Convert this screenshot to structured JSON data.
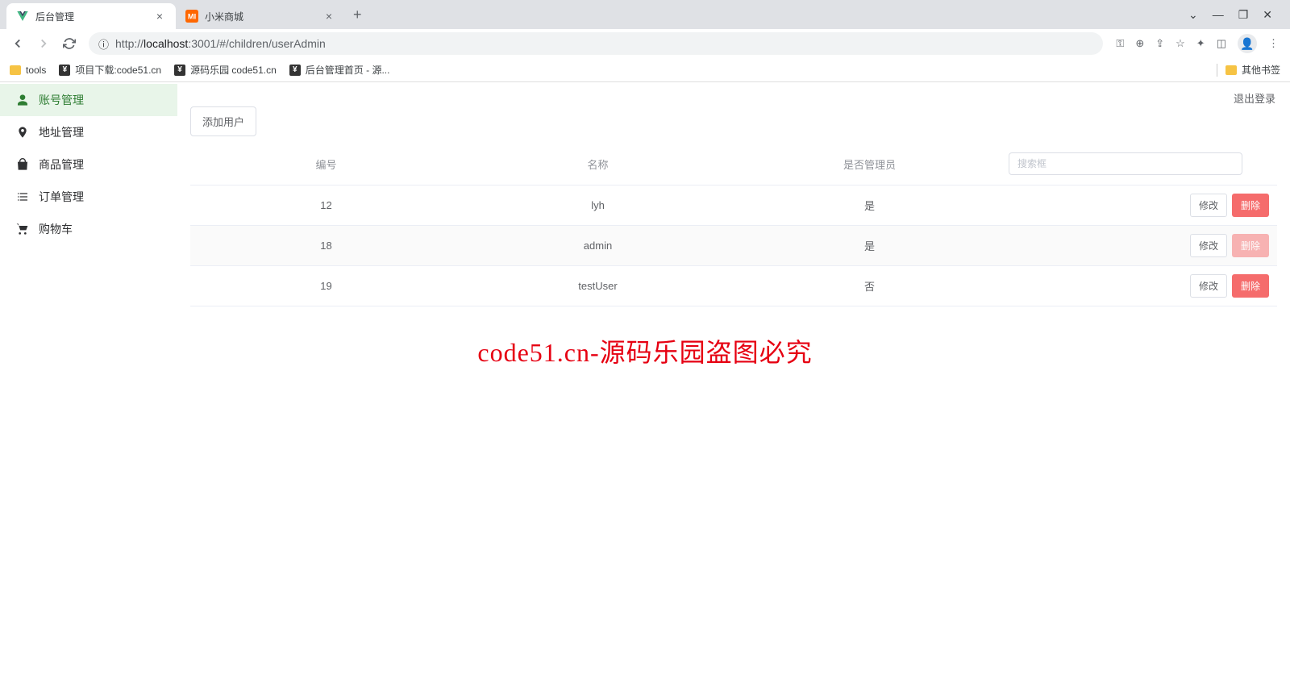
{
  "browser": {
    "tabs": [
      {
        "title": "后台管理",
        "active": true
      },
      {
        "title": "小米商城",
        "active": false
      }
    ],
    "url_prefix": "http://",
    "url_host": "localhost",
    "url_path": ":3001/#/children/userAdmin",
    "bookmarks": [
      {
        "label": "tools",
        "type": "folder"
      },
      {
        "label": "项目下载:code51.cn",
        "type": "link"
      },
      {
        "label": "源码乐园 code51.cn",
        "type": "link"
      },
      {
        "label": "后台管理首页 - 源...",
        "type": "link"
      }
    ],
    "other_bookmarks": "其他书签"
  },
  "app": {
    "logout": "退出登录",
    "sidebar": [
      {
        "label": "账号管理",
        "icon": "user",
        "active": true
      },
      {
        "label": "地址管理",
        "icon": "pin",
        "active": false
      },
      {
        "label": "商品管理",
        "icon": "bag",
        "active": false
      },
      {
        "label": "订单管理",
        "icon": "list",
        "active": false
      },
      {
        "label": "购物车",
        "icon": "cart",
        "active": false
      }
    ],
    "add_button": "添加用户",
    "table": {
      "headers": [
        "编号",
        "名称",
        "是否管理员",
        ""
      ],
      "search_placeholder": "搜索框",
      "edit_label": "修改",
      "delete_label": "删除",
      "rows": [
        {
          "id": "12",
          "name": "lyh",
          "admin": "是",
          "del_faded": false
        },
        {
          "id": "18",
          "name": "admin",
          "admin": "是",
          "del_faded": true
        },
        {
          "id": "19",
          "name": "testUser",
          "admin": "否",
          "del_faded": false
        }
      ]
    }
  },
  "watermark": "code51.cn-源码乐园盗图必究"
}
